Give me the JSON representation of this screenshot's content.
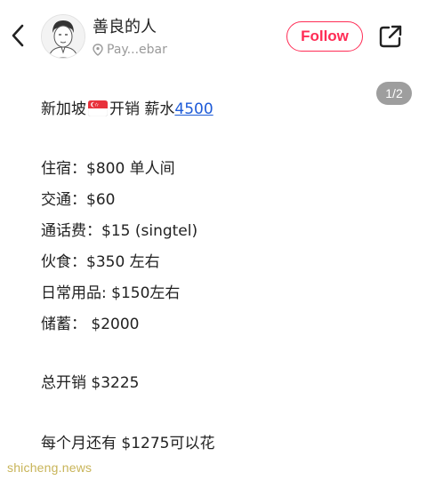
{
  "header": {
    "username": "善良的人",
    "location": "Pay...ebar",
    "follow_label": "Follow"
  },
  "page_indicator": "1/2",
  "post": {
    "title_prefix": "新加坡",
    "title_middle": "开销  薪水",
    "salary": "4500",
    "lines": [
      "住宿：$800 单人间",
      "交通：$60",
      "通话费：$15 (singtel)",
      "伙食：$350 左右",
      "日常用品: $150左右",
      "储蓄： $2000"
    ],
    "total": "总开销 $3225",
    "remaining": "每个月还有 $1275可以花"
  },
  "watermark": "shicheng.news"
}
